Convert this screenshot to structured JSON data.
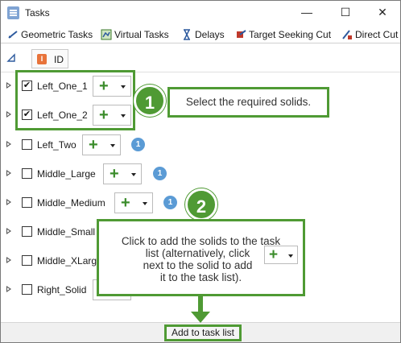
{
  "window": {
    "title": "Tasks",
    "minimize": "—",
    "maximize": "☐",
    "close": "✕"
  },
  "tabs": [
    {
      "label": "Geometric Tasks",
      "icon": "geometric-tasks-icon"
    },
    {
      "label": "Virtual Tasks",
      "icon": "virtual-tasks-icon"
    },
    {
      "label": "Delays",
      "icon": "hourglass-icon"
    },
    {
      "label": "Target Seeking Cut",
      "icon": "target-seeking-cut-icon"
    },
    {
      "label": "Direct Cut",
      "icon": "direct-cut-icon"
    }
  ],
  "column_header": {
    "id_label": "ID",
    "id_icon_text": "I"
  },
  "rows": [
    {
      "name": "Left_One_1",
      "checked": true,
      "badge": ""
    },
    {
      "name": "Left_One_2",
      "checked": true,
      "badge": ""
    },
    {
      "name": "Left_Two",
      "checked": false,
      "badge": "1"
    },
    {
      "name": "Middle_Large",
      "checked": false,
      "badge": "1"
    },
    {
      "name": "Middle_Medium",
      "checked": false,
      "badge": "1"
    },
    {
      "name": "Middle_Small",
      "checked": false,
      "badge": ""
    },
    {
      "name": "Middle_XLarge",
      "checked": false,
      "badge": ""
    },
    {
      "name": "Right_Solid",
      "checked": false,
      "badge": ""
    }
  ],
  "adder": {
    "plus": "+"
  },
  "annotations": {
    "step1_number": "1",
    "step1_text": "Select the required solids.",
    "step2_number": "2",
    "step2_line1": "Click to add the solids to the task",
    "step2_line2": "list (alternatively, click",
    "step2_line3": "next to the solid to add",
    "step2_line4": "it to the task list).",
    "accent_color": "#4f9a34"
  },
  "footer": {
    "add_button_label": "Add to task list"
  }
}
